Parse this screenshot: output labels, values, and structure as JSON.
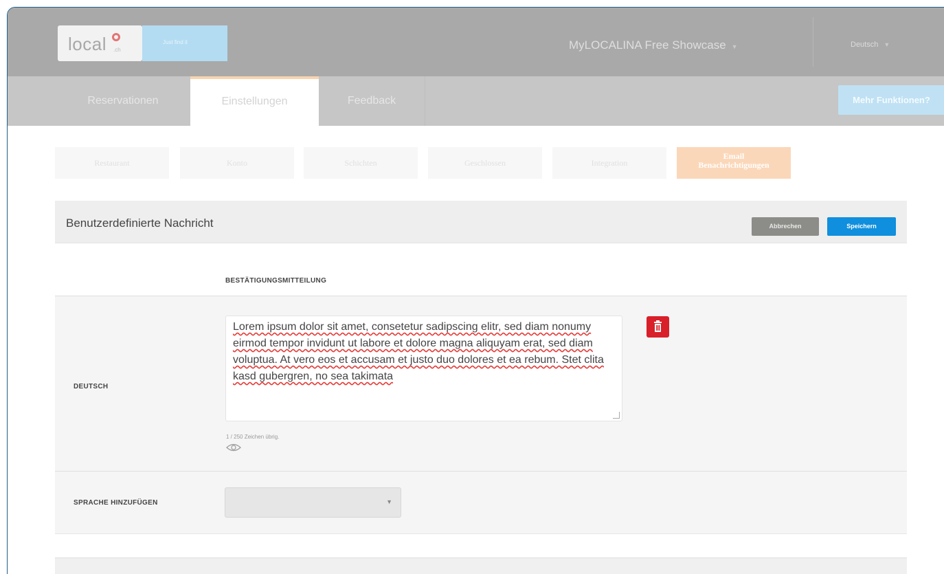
{
  "header": {
    "logo_text": "local",
    "logo_sub": ".ch",
    "tagline": "Just find it",
    "showcase": "MyLOCALINA Free Showcase",
    "language": "Deutsch"
  },
  "tabs": [
    {
      "label": "Reservationen",
      "active": false
    },
    {
      "label": "Einstellungen",
      "active": true
    },
    {
      "label": "Feedback",
      "active": false
    }
  ],
  "more_button": "Mehr Funktionen?",
  "subtabs": [
    {
      "label": "Restaurant"
    },
    {
      "label": "Konto"
    },
    {
      "label": "Schichten"
    },
    {
      "label": "Geschlossen"
    },
    {
      "label": "Integration"
    },
    {
      "label": "Email Benachrichtigungen",
      "line1": "Email",
      "line2": "Benachrichtigungen",
      "active": true
    }
  ],
  "section": {
    "title": "Benutzerdefinierte Nachricht",
    "cancel": "Abbrechen",
    "save": "Speichern",
    "column_header": "BESTÄTIGUNGSMITTEILUNG"
  },
  "message_row": {
    "label": "DEUTSCH",
    "text": "Lorem ipsum dolor sit amet, consetetur sadipscing elitr, sed diam nonumy eirmod tempor invidunt ut labore et dolore magna aliquyam erat, sed diam voluptua. At vero eos et accusam et justo duo dolores et ea rebum. Stet clita kasd gubergren, no sea takimata",
    "counter": "1 / 250 Zeichen übrig."
  },
  "add_language": {
    "label": "SPRACHE HINZUFÜGEN",
    "selected": ""
  },
  "colors": {
    "accent": "#0f8fdd",
    "danger": "#d81f2a",
    "active_tab": "#fbd7b9",
    "header": "#a9a9a9"
  }
}
